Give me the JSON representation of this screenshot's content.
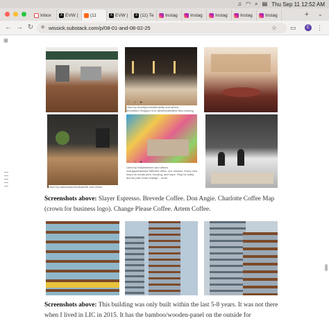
{
  "menubar": {
    "datetime": "Thu Sep 11  12:52 AM"
  },
  "tabs": [
    {
      "label": "Inbox",
      "icon": "gmail-icon",
      "active": false
    },
    {
      "label": "EVW |",
      "icon": "x-icon",
      "active": false
    },
    {
      "label": "(11",
      "icon": "substack-icon",
      "active": true
    },
    {
      "label": "EVW |",
      "icon": "x-icon",
      "active": false
    },
    {
      "label": "(11) Te",
      "icon": "x-icon",
      "active": false
    },
    {
      "label": "Instag",
      "icon": "instagram-icon",
      "active": false
    },
    {
      "label": "Instag",
      "icon": "instagram-icon",
      "active": false
    },
    {
      "label": "Instag",
      "icon": "instagram-icon",
      "active": false
    },
    {
      "label": "Instag",
      "icon": "instagram-icon",
      "active": false
    },
    {
      "label": "Instag",
      "icon": "instagram-icon",
      "active": false
    }
  ],
  "toolbar": {
    "url": "wissick.substack.com/p/08-01-and-08-02-25",
    "profile_initial": "E"
  },
  "article": {
    "caption1_bold": "Screenshots above:",
    "caption1_text": " Slayer Espresso. Brevede Coffee. Don Angie. Charlotte Coffee Map (crown for business logo). Change Please Coffee. Artem Coffee.",
    "caption2_bold": "Screenshots above:",
    "caption2_text": " This building was only built within the last 5-8 years. It was not there when I lived in LIC in 2015. It has the bamboo/wooden-panel on the outside for",
    "ig_post1": "Liked by ameejournelsbbmkrify and others\nbrevedlum Stopped in to @brevedecoffee this morning",
    "ig_post2": "Liked by hollybtbelmer and others\nchangepleasesea Different cities, one mission. Every visit helps us create jobs, housing, and hope. Stop by today and be part of the change... more",
    "ig_post3": "Liked by caliecaramelsofsantrills and others"
  },
  "colors": {
    "substack": "#ff6719",
    "profile": "#5b3fa8"
  }
}
